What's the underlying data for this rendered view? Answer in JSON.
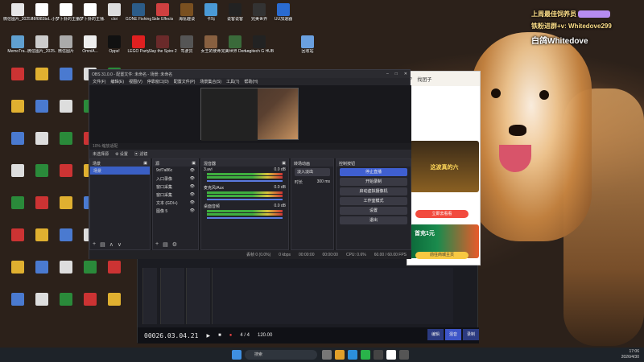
{
  "overlay": {
    "line1": "上周最佳饲养员",
    "line2": "铁粉进群+v: Whitedove299",
    "line3": "白鸽Whitedove"
  },
  "desktop_icons": [
    {
      "label": "微信图片_2025123...",
      "color": "#e6e6e6"
    },
    {
      "label": "48f6f83bd...",
      "color": "#fff"
    },
    {
      "label": "小梦卜卦的主播...",
      "color": "#fff"
    },
    {
      "label": "小梦卜卦的主播...",
      "color": "#fff"
    },
    {
      "label": "cloi",
      "color": "#ddd"
    },
    {
      "label": "GONE Fishing",
      "color": "#2c5c88"
    },
    {
      "label": "Side Effects",
      "color": "#d04040"
    },
    {
      "label": "海氪趣谈",
      "color": "#7a5020"
    },
    {
      "label": "卡玛",
      "color": "#4a9ad6"
    },
    {
      "label": "说客说客",
      "color": "#222"
    },
    {
      "label": "完美世界",
      "color": "#333"
    },
    {
      "label": "UU加速器",
      "color": "#2a6bd0"
    },
    {
      "label": "MemoTra...",
      "color": "#60a0d0"
    },
    {
      "label": "微信图片_2025...",
      "color": "#ccc"
    },
    {
      "label": "微信图片",
      "color": "#aaa"
    },
    {
      "label": "OmniA...",
      "color": "#eee"
    },
    {
      "label": "Opps!",
      "color": "#111"
    },
    {
      "label": "LEGO Party",
      "color": "#e02020"
    },
    {
      "label": "Slay the Spire 2",
      "color": "#6a2a2a"
    },
    {
      "label": "驾驶员",
      "color": "#555"
    },
    {
      "label": "女王的使命",
      "color": "#886040"
    },
    {
      "label": "完美世界 Demo",
      "color": "#3a6a3a"
    },
    {
      "label": "Logitech G HUB",
      "color": "#222"
    },
    {
      "label": "回收站",
      "color": "#6aa0e0"
    }
  ],
  "obs": {
    "title": "OBS 31.0.0 - 配置文件: 未命名 - 场景: 未命名",
    "menu": [
      "文件(F)",
      "编辑(E)",
      "视图(V)",
      "停靠窗口(D)",
      "配置文件(P)",
      "场景集合(S)",
      "工具(T)",
      "帮助(H)"
    ],
    "status_left": "10%  缩放适配",
    "source_bar": [
      "未选择源",
      "设置",
      "滤镜"
    ],
    "docks": {
      "scenes": {
        "title": "场景",
        "items": [
          "场景"
        ]
      },
      "sources": {
        "title": "源",
        "items": [
          "9cf7a86c",
          "入口录像",
          "窗口采集",
          "窗口采集",
          "文本 (GDI+)",
          "图像 5"
        ]
      },
      "mixer": {
        "title": "混音器",
        "tracks": [
          {
            "name": "3.avi",
            "db": "0.0 dB"
          },
          {
            "name": "麦克风/Aux",
            "db": "0.0 dB"
          },
          {
            "name": "桌面音频",
            "db": "0.0 dB"
          }
        ]
      },
      "transitions": {
        "title": "转场动画",
        "type": "淡入淡出",
        "duration_label": "时长",
        "duration": "300 ms"
      },
      "controls": {
        "title": "控制按钮",
        "buttons": [
          "停止直播",
          "开始录制",
          "启动虚拟摄像机",
          "工作室模式",
          "设置",
          "退出"
        ]
      }
    },
    "footer": [
      "丢帧 0 (0.0%)",
      "0 kbps",
      "00:00:00",
      "00:00:00",
      "CPU: 0.6%",
      "60.00 / 60.00 FPS"
    ]
  },
  "daw": {
    "time": "00026.03.04.21",
    "bar": "4 / 4",
    "tempo": "120.00",
    "modes": [
      "编辑",
      "混音",
      "录制"
    ]
  },
  "app": {
    "search_placeholder": "找团子",
    "banner_title": "这波真的六",
    "redbtn": "立即去看看",
    "greenbtn": "前往商城主页",
    "promo": "首充1元"
  },
  "taskbar": {
    "search_placeholder": "搜索",
    "time": "17:06",
    "date": "2026/4/30"
  }
}
